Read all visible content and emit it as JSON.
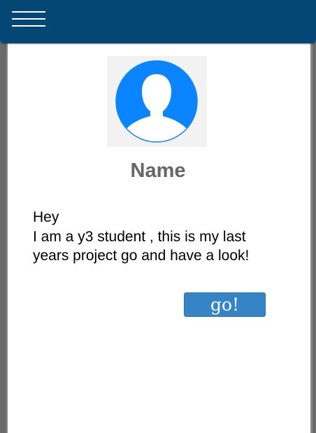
{
  "header": {
    "menu_icon": "hamburger-menu-icon",
    "background_color": "#044775"
  },
  "profile": {
    "avatar_icon": "user-silhouette-icon",
    "avatar_color": "#0a84ff",
    "name": "Name",
    "bio_line_1": "Hey",
    "bio_line_2": "I am  a y3 student , this is my last",
    "bio_line_3": "years project go and have a look!"
  },
  "actions": {
    "go_label": "go!",
    "go_color": "#3585c6"
  }
}
